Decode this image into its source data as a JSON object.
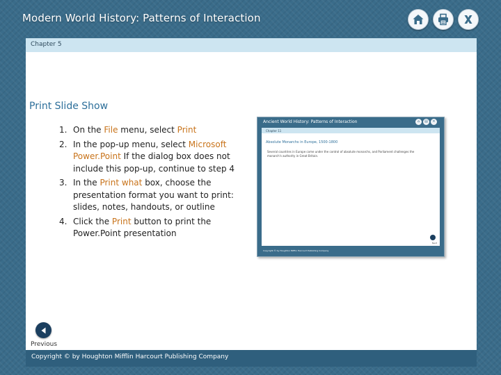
{
  "header": {
    "app_title": "Modern World History: Patterns of Interaction",
    "icons": [
      "home-icon",
      "print-icon",
      "close-icon"
    ]
  },
  "chapter": {
    "label": "Chapter 5"
  },
  "main": {
    "section_title": "Print Slide Show",
    "steps": [
      {
        "num": "1.",
        "parts": [
          "On the ",
          "File",
          " menu, select ",
          "Print"
        ]
      },
      {
        "num": "2.",
        "parts": [
          "In the pop-up menu, select ",
          "Microsoft Power.Point",
          " If the dialog box does not include this pop-up, continue to step 4"
        ]
      },
      {
        "num": "3.",
        "parts": [
          "In the ",
          "Print what",
          " box, choose the presentation format you want to print: slides, notes, handouts, or outline"
        ]
      },
      {
        "num": "4.",
        "parts": [
          "Click the ",
          "Print",
          " button to print the Power.Point presentation"
        ]
      }
    ]
  },
  "thumbnail": {
    "title": "Ancient World History: Patterns of Interaction",
    "chapter": "Chapter 11",
    "heading": "Absolute Monarchs in Europe, 1500-1800",
    "text": "Several countries in Europe come under the control of absolute monarchs, and Parliament challenges the monarch's authority in Great Britain.",
    "next_label": "Next",
    "footer": "Copyright © by Houghton Mifflin Harcourt Publishing Company"
  },
  "nav": {
    "previous_label": "Previous"
  },
  "footer": {
    "copyright": "Copyright © by Houghton Mifflin Harcourt Publishing Company"
  },
  "colors": {
    "background": "#3a6c8a",
    "chapter_bar": "#cde5f1",
    "title_blue": "#2d6f9a",
    "highlight": "#c8731a",
    "nav_button": "#1b3f5f"
  }
}
